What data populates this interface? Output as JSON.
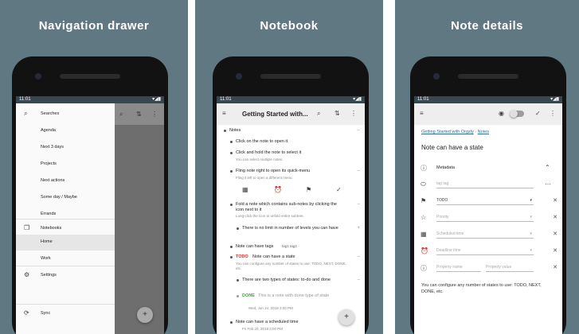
{
  "panels": {
    "drawer": {
      "caption": "Navigation drawer",
      "status_time": "11:01",
      "drawer_items": [
        {
          "label": "Searches"
        },
        {
          "label": "Agenda"
        },
        {
          "label": "Next 3 days"
        },
        {
          "label": "Projects"
        },
        {
          "label": "Next actions"
        },
        {
          "label": "Some day / Maybe"
        },
        {
          "label": "Errands"
        },
        {
          "label": "Notebooks"
        },
        {
          "label": "Home"
        },
        {
          "label": "Work"
        },
        {
          "label": "Settings"
        },
        {
          "label": "Sync"
        }
      ]
    },
    "notebook": {
      "caption": "Notebook",
      "status_time": "11:01",
      "title": "Getting Started with...",
      "notes": [
        {
          "text": "Notes"
        },
        {
          "text": "Click on the note to open it"
        },
        {
          "text": "Click and hold the note to select it",
          "sub": "You can select multiple notes."
        },
        {
          "text": "Fling note right to open its quick-menu",
          "sub": "Fling it left to open a different menu."
        },
        {
          "text": "Fold a note which contains sub-notes by clicking the icon next to it",
          "sub": "Long-click the icon to unfold entire subtree."
        },
        {
          "text": "There is no limit in number of levels you can have"
        },
        {
          "text": "Note can have tags",
          "tags": "tag1 tag2"
        },
        {
          "state": "TODO",
          "text": "Note can have a state",
          "sub": "You can configure any number of states to use: TODO, NEXT, DONE, etc."
        },
        {
          "text": "There are two types of states: to-do and done"
        },
        {
          "state": "DONE",
          "text": "This is a note with done type of state",
          "sub": "Wed, Jun 24, 2018 3:00 PM"
        },
        {
          "text": "Note can have a scheduled time",
          "sub": "Fri Feb 20, 2018 3:00 PM"
        }
      ]
    },
    "details": {
      "caption": "Note details",
      "status_time": "11:01",
      "breadcrumb_book": "Getting Started with Orgzly",
      "breadcrumb_sep": "›",
      "breadcrumb_note": "Notes",
      "title": "Note can have a state",
      "metadata_label": "Metadata",
      "tags_placeholder": "tag tag",
      "state_value": "TODO",
      "priority_placeholder": "Priority",
      "scheduled_placeholder": "Scheduled time",
      "deadline_placeholder": "Deadline time",
      "property_name_placeholder": "Property name",
      "property_value_placeholder": "Property value",
      "body": "You can configure any number of states to use: TODO, NEXT, DONE, etc."
    }
  },
  "colors": {
    "background": "#5f7882",
    "status_bar": "#37474f",
    "todo": "#d32f2f",
    "done": "#43a047",
    "link": "#2e6f9e"
  },
  "icons": {
    "search": "search-icon",
    "menu": "hamburger-menu-icon",
    "more": "more-vert-icon",
    "sort": "sort-icon",
    "add": "plus-icon",
    "settings": "gear-icon",
    "sync": "sync-icon",
    "notebooks": "notebooks-icon",
    "eye": "eye-icon",
    "check": "check-icon"
  }
}
